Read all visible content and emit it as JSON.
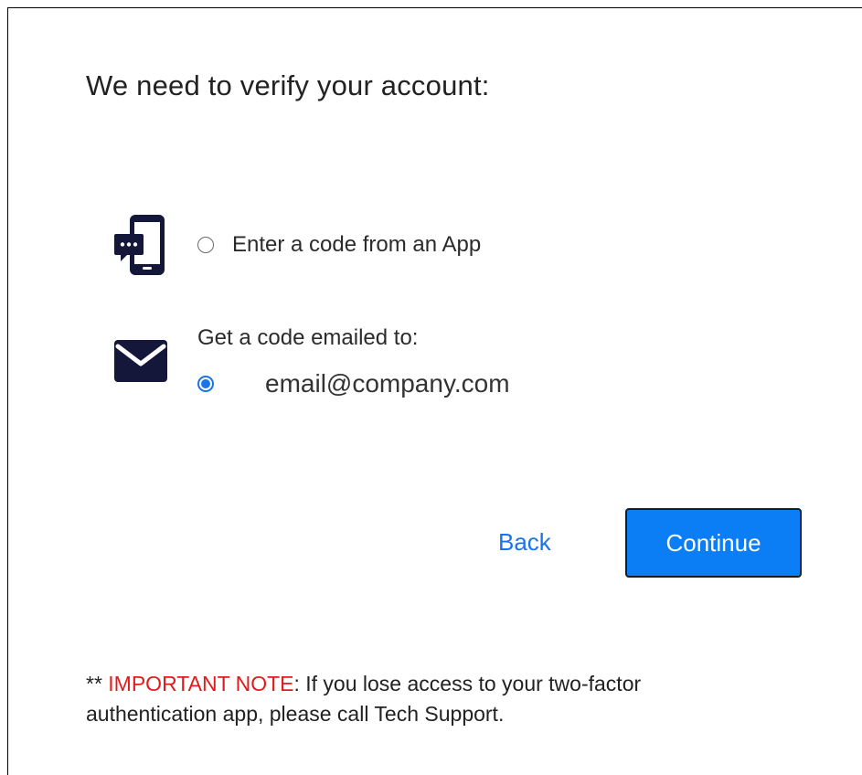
{
  "page": {
    "title": "We need to verify your account:"
  },
  "options": {
    "app": {
      "label": "Enter a code from an App",
      "icon": "mobile-phone-icon",
      "selected": false
    },
    "email": {
      "heading": "Get a code emailed to:",
      "address": "email@company.com",
      "icon": "envelope-icon",
      "selected": true
    }
  },
  "actions": {
    "back_label": "Back",
    "continue_label": "Continue"
  },
  "note": {
    "prefix": "** ",
    "important": "IMPORTANT NOTE",
    "body": ": If you lose access to your two-factor authentication app, please call Tech Support."
  },
  "colors": {
    "accent": "#0b7ef5",
    "link": "#1a73e8",
    "important": "#e01b1b",
    "icon": "#14163a"
  }
}
